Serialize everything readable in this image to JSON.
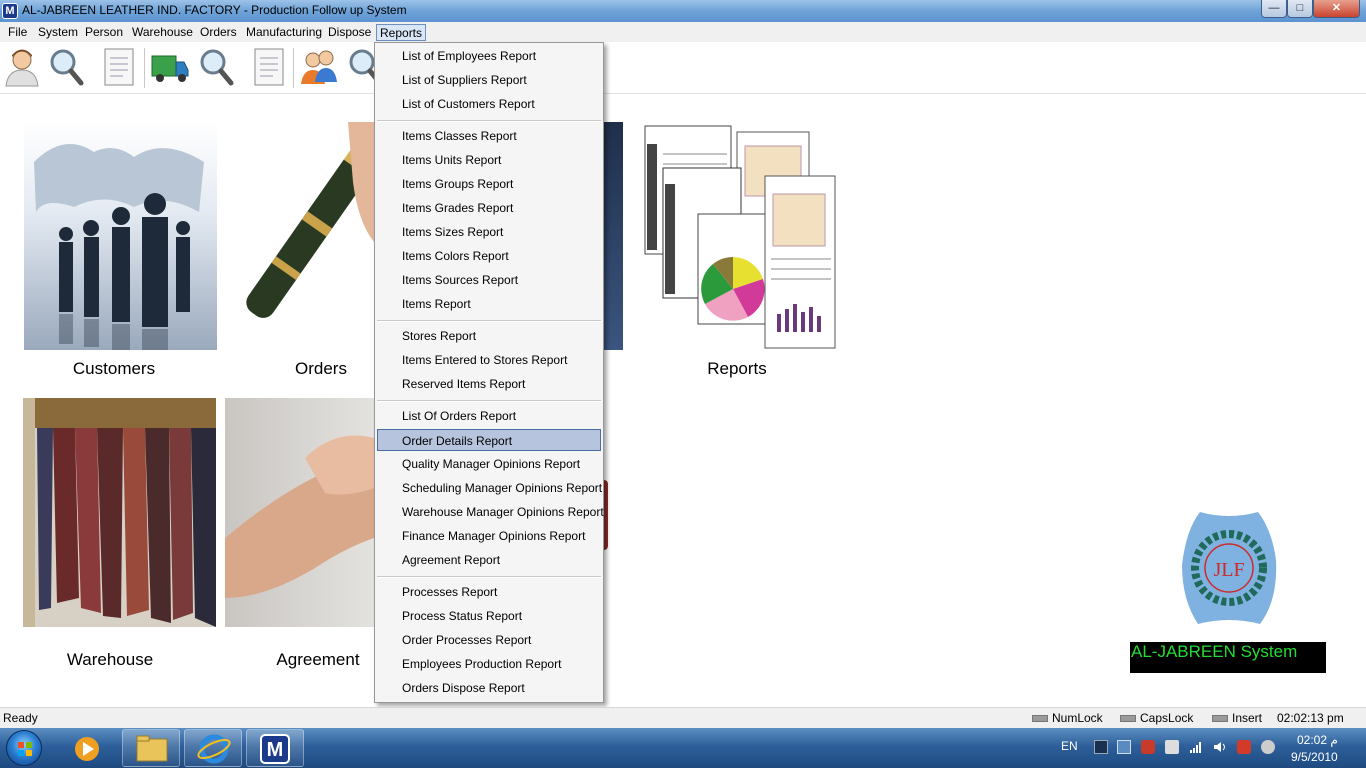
{
  "window": {
    "title": "AL-JABREEN LEATHER IND. FACTORY - Production Follow up System",
    "app_icon_letter": "M",
    "min_symbol": "—",
    "max_symbol": "□",
    "close_symbol": "✕"
  },
  "menubar": {
    "items": [
      "File",
      "System",
      "Person",
      "Warehouse",
      "Orders",
      "Manufacturing",
      "Dispose",
      "Reports"
    ],
    "active": "Reports"
  },
  "toolbar": {
    "icons": [
      "person-icon",
      "search-icon",
      "document-icon",
      "truck-icon",
      "search-icon",
      "document-icon",
      "users-icon",
      "search-icon"
    ]
  },
  "tiles": [
    {
      "label": "Customers"
    },
    {
      "label": "Orders"
    },
    {
      "label": "Reports"
    },
    {
      "label": "Warehouse"
    },
    {
      "label": "Agreement"
    }
  ],
  "logo": {
    "letters": "JLF",
    "caption": "AL-JABREEN System"
  },
  "reports_menu": {
    "groups": [
      [
        "List of Employees Report",
        "List of Suppliers Report",
        "List of Customers Report"
      ],
      [
        "Items Classes Report",
        "Items Units Report",
        "Items Groups Report",
        "Items Grades Report",
        "Items Sizes Report",
        "Items Colors Report",
        "Items Sources Report",
        "Items Report"
      ],
      [
        "Stores Report",
        "Items Entered to Stores Report",
        "Reserved Items Report"
      ],
      [
        "List Of Orders Report",
        "Order Details Report",
        "Quality Manager Opinions Report",
        "Scheduling Manager Opinions Report",
        "Warehouse Manager Opinions Report",
        "Finance Manager Opinions Report",
        "Agreement Report"
      ],
      [
        "Processes Report",
        "Process Status Report",
        "Order Processes Report",
        "Employees Production Report",
        "Orders Dispose Report"
      ]
    ],
    "highlighted": "Order Details Report"
  },
  "statusbar": {
    "status": "Ready",
    "numlock": "NumLock",
    "capslock": "CapsLock",
    "insert": "Insert",
    "time": "02:02:13 pm"
  },
  "taskbar": {
    "language": "EN",
    "clock_time": "02:02 م",
    "clock_date": "9/5/2010",
    "pinned": [
      "media-player-icon",
      "file-explorer-icon",
      "internet-explorer-icon",
      "app-icon"
    ]
  },
  "colors": {
    "menu_highlight": "#b7c4dd",
    "logo_caption_text": "#22dd33",
    "logo_blue": "#7fb2e0",
    "logo_red": "#cc2b2b"
  }
}
